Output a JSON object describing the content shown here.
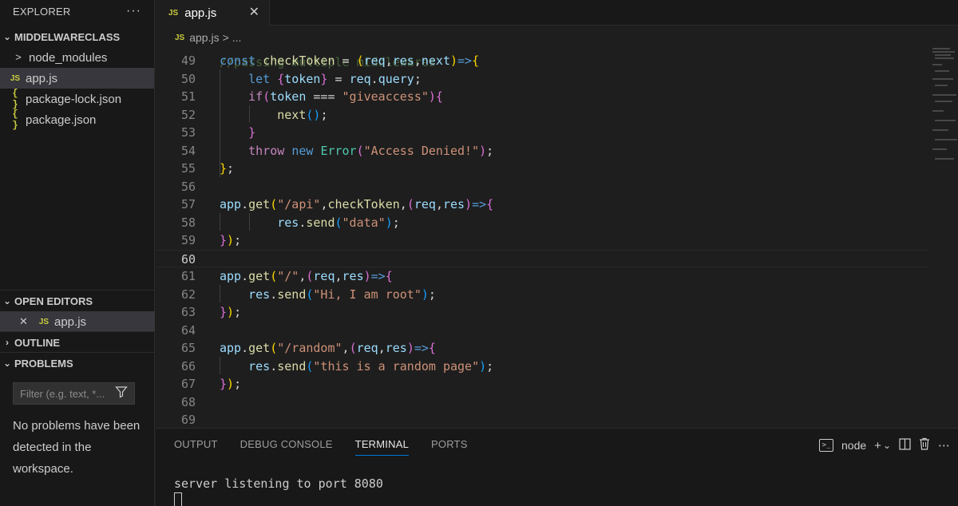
{
  "explorer": {
    "title": "EXPLORER",
    "more": "···",
    "folder": "MIDDELWARECLASS",
    "items": [
      {
        "label": "node_modules",
        "icon": ">"
      },
      {
        "label": "app.js",
        "icon": "JS"
      },
      {
        "label": "package-lock.json",
        "icon": "{ }"
      },
      {
        "label": "package.json",
        "icon": "{ }"
      }
    ]
  },
  "open_editors": {
    "title": "OPEN EDITORS",
    "close": "✕",
    "icon": "JS",
    "file": "app.js"
  },
  "outline": {
    "title": "OUTLINE"
  },
  "problems": {
    "title": "PROBLEMS",
    "filter_placeholder": "Filter (e.g. text, *...",
    "message": "No problems have been detected in the workspace."
  },
  "tab": {
    "icon": "JS",
    "label": "app.js",
    "close": "✕"
  },
  "breadcrumb": {
    "icon": "JS",
    "file": "app.js",
    "sep": ">",
    "more": "..."
  },
  "code": {
    "line_numbers": [
      "49",
      "50",
      "51",
      "52",
      "53",
      "54",
      "55",
      "56",
      "57",
      "58",
      "59",
      "60",
      "61",
      "62",
      "63",
      "64",
      "65",
      "66",
      "67",
      "68",
      "69"
    ],
    "current_line": "60",
    "ghost_line": "//passing multiple middlewares"
  },
  "panel": {
    "tabs": [
      "OUTPUT",
      "DEBUG CONSOLE",
      "TERMINAL",
      "PORTS"
    ],
    "active_tab": "TERMINAL",
    "terminal_name": "node",
    "terminal_output": "server listening to port 8080"
  },
  "colors": {
    "accent": "#0078d4",
    "js_icon": "#cbcb41"
  }
}
